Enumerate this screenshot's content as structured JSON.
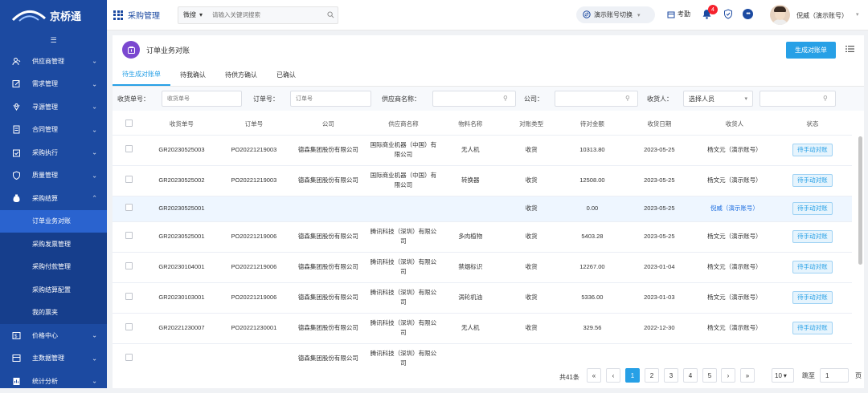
{
  "brand": {
    "name": "京桥通"
  },
  "topbar": {
    "module": "采购管理",
    "search_scope": "微搜",
    "search_placeholder": "请输入关键词搜索",
    "account_switch": "演示账号切换",
    "attendance": "考勤",
    "notification_count": "4",
    "user_name": "倪威（演示账号）"
  },
  "sidebar": {
    "items": [
      {
        "label": "供应商管理",
        "icon": "supplier-icon"
      },
      {
        "label": "需求管理",
        "icon": "edit-icon"
      },
      {
        "label": "寻源管理",
        "icon": "source-icon"
      },
      {
        "label": "合同管理",
        "icon": "contract-icon"
      },
      {
        "label": "采购执行",
        "icon": "execution-icon"
      },
      {
        "label": "质量管理",
        "icon": "quality-icon"
      },
      {
        "label": "采购结算",
        "icon": "settlement-icon"
      }
    ],
    "sub_items": [
      "订单业务对账",
      "采购发票管理",
      "采购付款管理",
      "采购结算配置",
      "我的票夹"
    ],
    "bottom_items": [
      {
        "label": "价格中心",
        "icon": "price-icon"
      },
      {
        "label": "主数据管理",
        "icon": "masterdata-icon"
      },
      {
        "label": "统计分析",
        "icon": "stats-icon"
      }
    ]
  },
  "page": {
    "title": "订单业务对账",
    "generate_button": "生成对账单",
    "tabs": [
      "待生成对账单",
      "待我确认",
      "待供方确认",
      "已确认"
    ],
    "filters": {
      "receipt_no_label": "收货单号：",
      "receipt_no_placeholder": "收货单号",
      "order_no_label": "订单号：",
      "order_no_placeholder": "订单号",
      "supplier_label": "供应商名称：",
      "company_label": "公司：",
      "receiver_label": "收货人：",
      "receiver_select": "选择人员"
    }
  },
  "table": {
    "headers": [
      "收货单号",
      "订单号",
      "公司",
      "供应商名称",
      "物料名称",
      "对账类型",
      "待对金额",
      "收货日期",
      "收货人",
      "状态"
    ],
    "rows": [
      {
        "receipt": "GR20230525003",
        "order": "PO20221219003",
        "company": "德森集团股份有限公司",
        "supplier": "国际商业机器（中国）有限公司",
        "material": "无人机",
        "type": "收货",
        "amount": "10313.80",
        "date": "2023-05-25",
        "receiver": "杨文元（演示账号）",
        "status": "待手动对账"
      },
      {
        "receipt": "GR20230525002",
        "order": "PO20221219003",
        "company": "德森集团股份有限公司",
        "supplier": "国际商业机器（中国）有限公司",
        "material": "转换器",
        "type": "收货",
        "amount": "12508.00",
        "date": "2023-05-25",
        "receiver": "杨文元（演示账号）",
        "status": "待手动对账"
      },
      {
        "receipt": "GR20230525001",
        "order": "",
        "company": "",
        "supplier": "",
        "material": "",
        "type": "收货",
        "amount": "0.00",
        "date": "2023-05-25",
        "receiver": "倪威（演示账号）",
        "status": "待手动对账"
      },
      {
        "receipt": "GR20230525001",
        "order": "PO20221219006",
        "company": "德森集团股份有限公司",
        "supplier": "腾讯科技（深圳）有限公司",
        "material": "多肉植物",
        "type": "收货",
        "amount": "5403.28",
        "date": "2023-05-25",
        "receiver": "杨文元（演示账号）",
        "status": "待手动对账"
      },
      {
        "receipt": "GR20230104001",
        "order": "PO20221219006",
        "company": "德森集团股份有限公司",
        "supplier": "腾讯科技（深圳）有限公司",
        "material": "禁烟标识",
        "type": "收货",
        "amount": "12267.00",
        "date": "2023-01-04",
        "receiver": "杨文元（演示账号）",
        "status": "待手动对账"
      },
      {
        "receipt": "GR20230103001",
        "order": "PO20221219006",
        "company": "德森集团股份有限公司",
        "supplier": "腾讯科技（深圳）有限公司",
        "material": "涡轮机油",
        "type": "收货",
        "amount": "5336.00",
        "date": "2023-01-03",
        "receiver": "杨文元（演示账号）",
        "status": "待手动对账"
      },
      {
        "receipt": "GR20221230007",
        "order": "PO20221230001",
        "company": "德森集团股份有限公司",
        "supplier": "腾讯科技（深圳）有限公司",
        "material": "无人机",
        "type": "收货",
        "amount": "329.56",
        "date": "2022-12-30",
        "receiver": "杨文元（演示账号）",
        "status": "待手动对账"
      },
      {
        "receipt": "",
        "order": "",
        "company": "德森集团股份有限公司",
        "supplier": "腾讯科技（深圳）有限公司",
        "material": "",
        "type": "",
        "amount": "",
        "date": "",
        "receiver": "",
        "status": ""
      }
    ]
  },
  "pager": {
    "total": "共41条",
    "pages": [
      "1",
      "2",
      "3",
      "4",
      "5"
    ],
    "current": "1",
    "page_size": "10",
    "jump_label": "跳至",
    "jump_value": "1",
    "page_suffix": "页"
  },
  "colors": {
    "sidebar": "#1c4aa1",
    "accent": "#27a0e6",
    "page_icon": "#7b48d0"
  }
}
